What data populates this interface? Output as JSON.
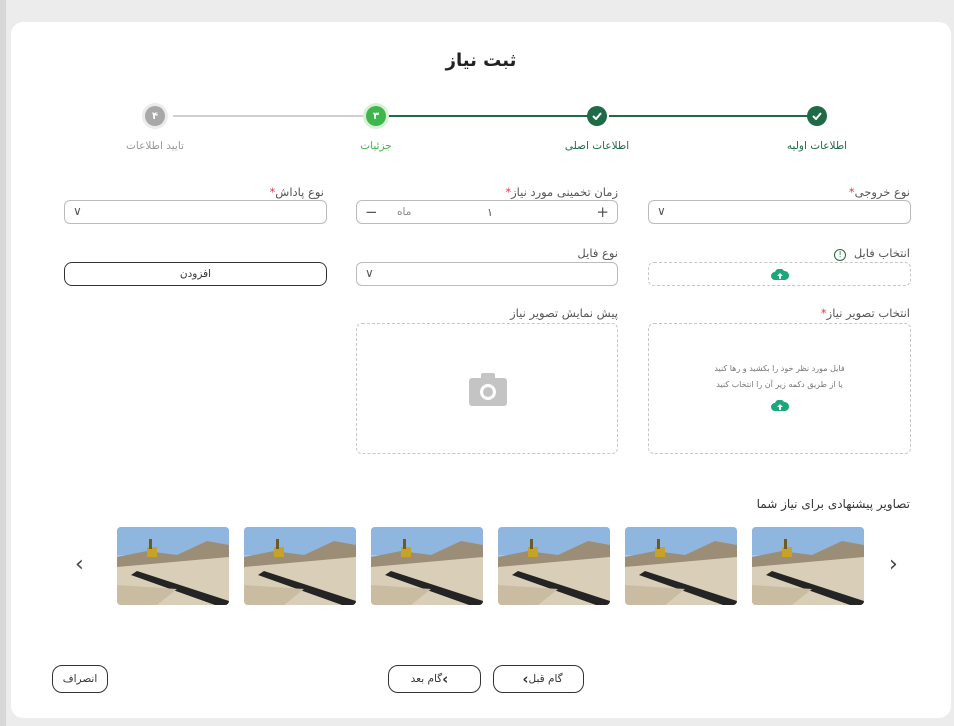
{
  "page": {
    "title": "ثبت نیاز"
  },
  "colors": {
    "accent": "#1e6b46",
    "muted": "#a8a8a8",
    "required": "#e2384d",
    "upload": "#1aa77a"
  },
  "steps": [
    {
      "label": "اطلاعات اولیه",
      "state": "done"
    },
    {
      "label": "اطلاعات اصلی",
      "state": "done"
    },
    {
      "label": "جزئیات",
      "state": "active",
      "num": "۳"
    },
    {
      "label": "تایید اطلاعات",
      "state": "pending",
      "num": "۴"
    }
  ],
  "form": {
    "output_type": {
      "label": "نوع خروجی",
      "req": "*",
      "value": ""
    },
    "time_estimate": {
      "label": "زمان تخمینی مورد نیاز",
      "req": "*",
      "value": "۱",
      "unit": "ماه",
      "plus": "+",
      "minus": "−"
    },
    "reward_type": {
      "label": "نوع پاداش",
      "req": "*",
      "value": ""
    },
    "file_select": {
      "label": "انتخاب فایل"
    },
    "file_type": {
      "label": "نوع فایل",
      "value": ""
    },
    "add_button": "افزودن",
    "image_select": {
      "label": "انتخاب تصویر نیاز",
      "req": "*",
      "hint1": "فایل مورد نظر خود را بکشید و رها کنید",
      "hint2": "یا از طریق دکمه زیر آن را انتخاب کنید"
    },
    "preview": {
      "label": "پیش نمایش تصویر نیاز"
    }
  },
  "suggested": {
    "title": "تصاویر پیشنهادی برای نیاز شما",
    "count": 6
  },
  "footer": {
    "prev": "گام قبل",
    "next": "گام بعد",
    "cancel": "انصراف"
  }
}
